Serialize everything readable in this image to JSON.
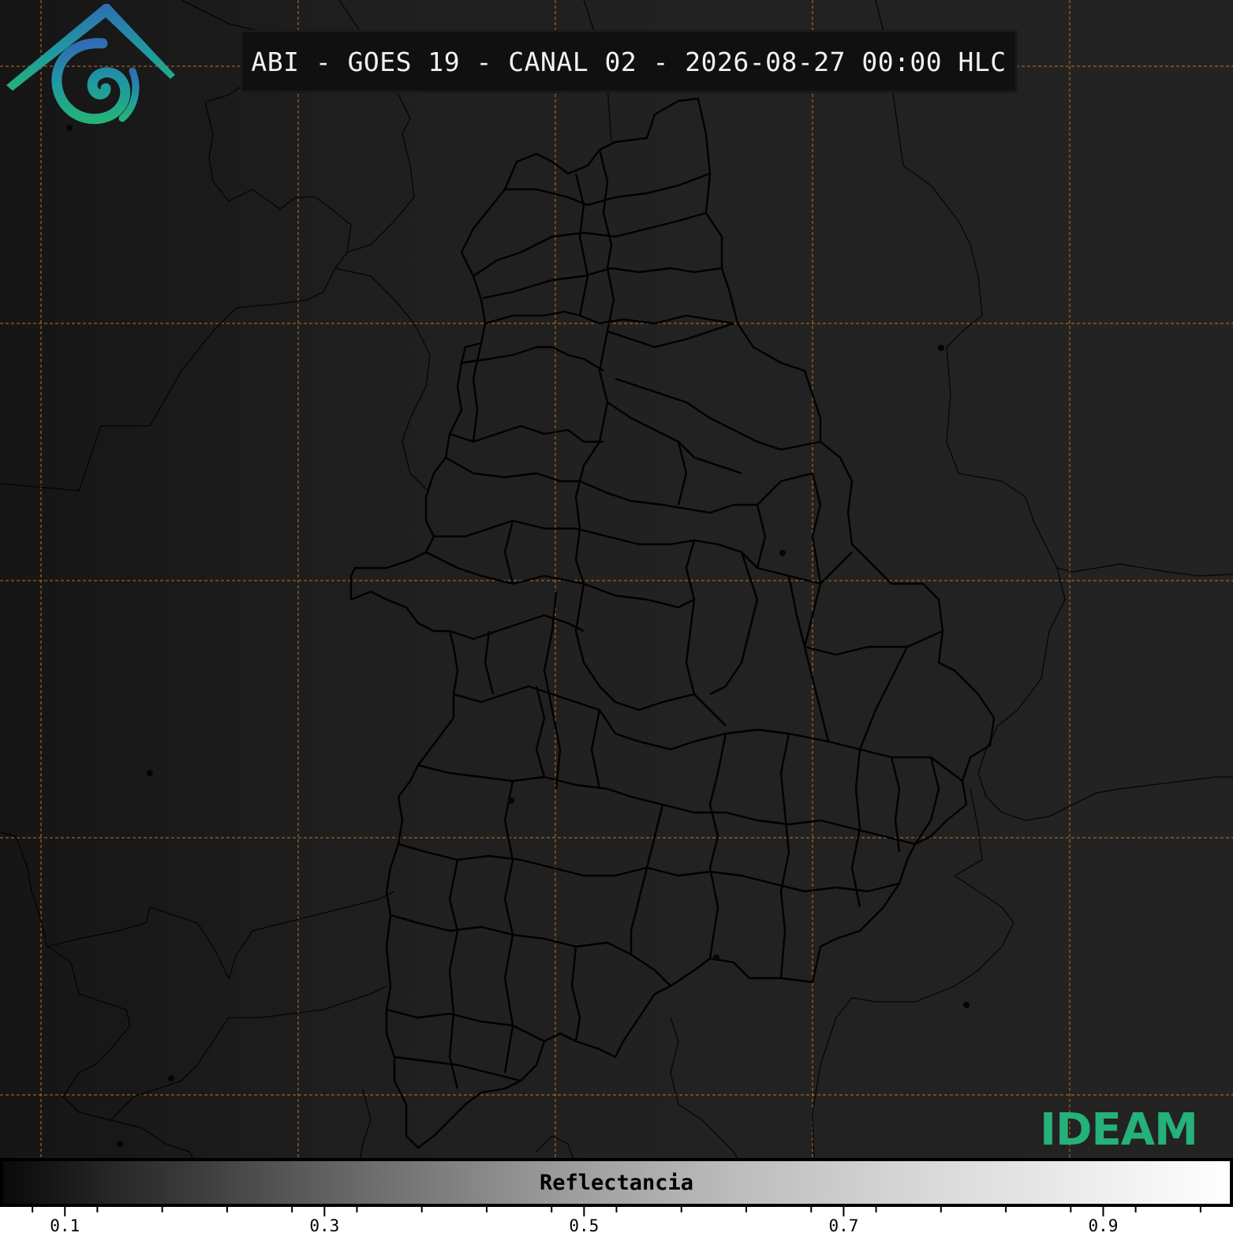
{
  "title": "ABI - GOES 19 - CANAL 02 - 2026-08-27 00:00 HLC",
  "colorbar": {
    "label": "Reflectancia",
    "min": 0.05,
    "max": 1.0,
    "tick_labels": [
      {
        "value": 0.1,
        "label": "0.1"
      },
      {
        "value": 0.3,
        "label": "0.3"
      },
      {
        "value": 0.5,
        "label": "0.5"
      },
      {
        "value": 0.7,
        "label": "0.7"
      },
      {
        "value": 0.9,
        "label": "0.9"
      }
    ],
    "minor_tick_step": 0.025
  },
  "logo": {
    "text": "IDEAM",
    "colors": {
      "top": "#2f6db3",
      "middle": "#1f9aa0",
      "bottom": "#25b17a"
    }
  },
  "graticule_color": "#c8701e",
  "boundary_color": "#000000"
}
